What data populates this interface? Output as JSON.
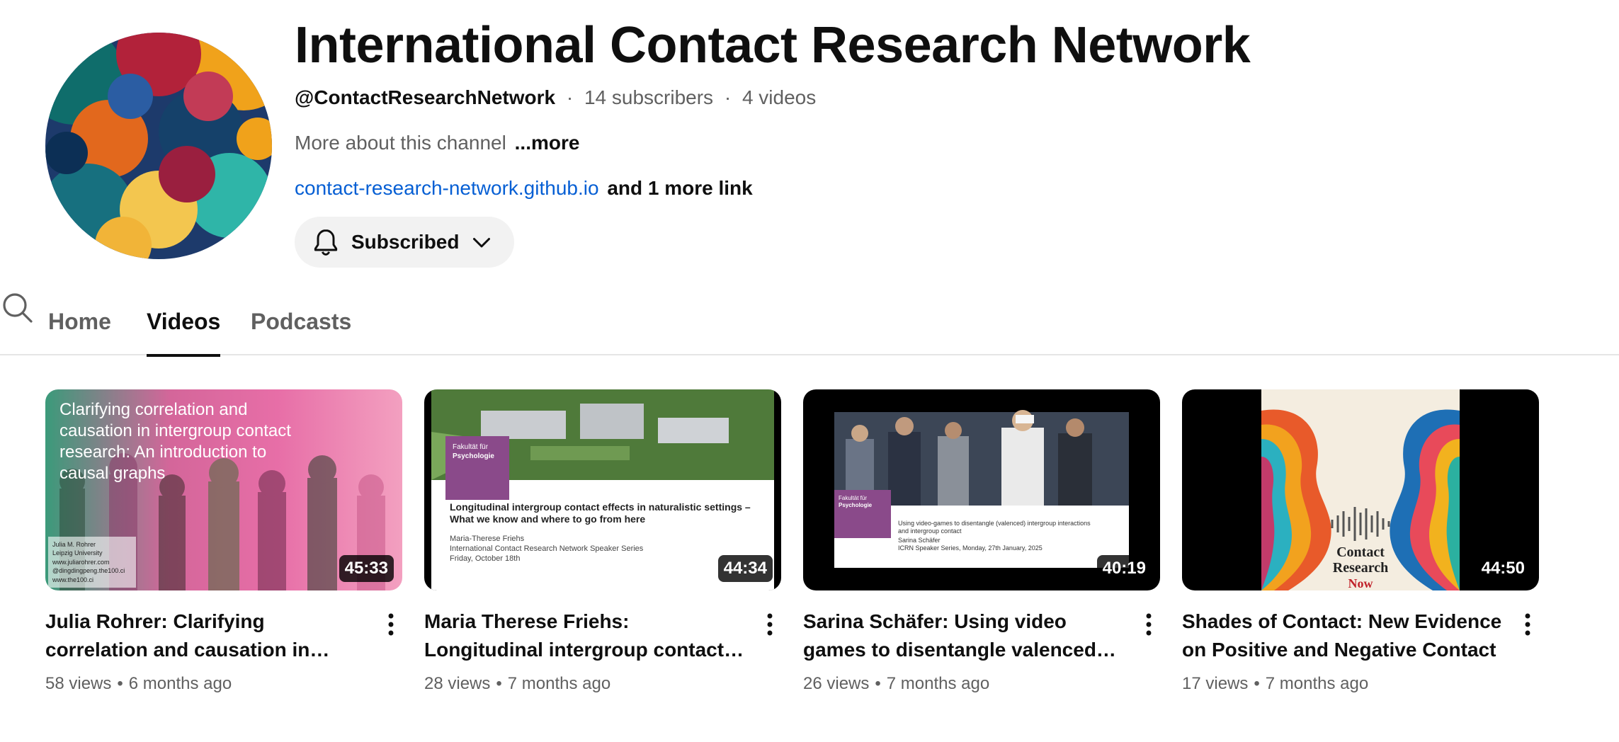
{
  "channel": {
    "title": "International Contact Research Network",
    "handle": "@ContactResearchNetwork",
    "subscribers": "14 subscribers",
    "videos_count": "4 videos",
    "meta_separator": "·",
    "about": "More about this channel",
    "about_more": "...more",
    "link": "contact-research-network.github.io",
    "more_links": "and 1 more link",
    "subscribe_label": "Subscribed"
  },
  "tabs": [
    {
      "label": "Home",
      "active": false
    },
    {
      "label": "Videos",
      "active": true
    },
    {
      "label": "Podcasts",
      "active": false
    }
  ],
  "videos": [
    {
      "title": "Julia Rohrer: Clarifying correlation and causation in intergroup contac…",
      "duration": "45:33",
      "views": "58 views",
      "age": "6 months ago",
      "thumb_text": [
        "Clarifying correlation and",
        "causation in intergroup contact",
        "research: An introduction to",
        "causal graphs"
      ],
      "thumb_credit": [
        "Julia M. Rohrer",
        "Leipzig University",
        "www.juliarohrer.com",
        "@dingdingpeng.the100.ci",
        "www.the100.ci"
      ]
    },
    {
      "title": "Maria Therese Friehs: Longitudinal intergroup contact effects in…",
      "duration": "44:34",
      "views": "28 views",
      "age": "7 months ago",
      "thumb_badge": [
        "Fakultät für",
        "Psychologie"
      ],
      "thumb_text": [
        "Longitudinal intergroup contact effects in naturalistic settings –",
        "What we know and where to go from here"
      ],
      "thumb_sub": [
        "Maria-Therese Friehs",
        "International Contact Research Network Speaker Series",
        "Friday, October 18th"
      ]
    },
    {
      "title": "Sarina Schäfer: Using video games to disentangle valenced intergroup…",
      "duration": "40:19",
      "views": "26 views",
      "age": "7 months ago",
      "thumb_badge": [
        "Fakultät für",
        "Psychologie"
      ],
      "thumb_text": [
        "Using video-games to disentangle (valenced) intergroup interactions",
        "and intergroup contact"
      ],
      "thumb_sub": [
        "Sarina Schäfer",
        "ICRN Speaker Series, Monday, 27th January, 2025"
      ]
    },
    {
      "title": "Shades of Contact: New Evidence on Positive and Negative Contact",
      "duration": "44:50",
      "views": "17 views",
      "age": "7 months ago",
      "thumb_logo": [
        "Contact",
        "Research",
        "Now"
      ]
    }
  ],
  "meta_separator": "•",
  "colors": {
    "link": "#065fd4",
    "text_primary": "#0f0f0f",
    "text_secondary": "#606060",
    "chip_bg": "#f2f2f2",
    "fernuni_purple": "#8a4a8a"
  },
  "icons": {
    "bell": "bell-icon",
    "chevron": "chevron-down-icon",
    "search": "search-icon",
    "more": "more-vert-icon"
  }
}
